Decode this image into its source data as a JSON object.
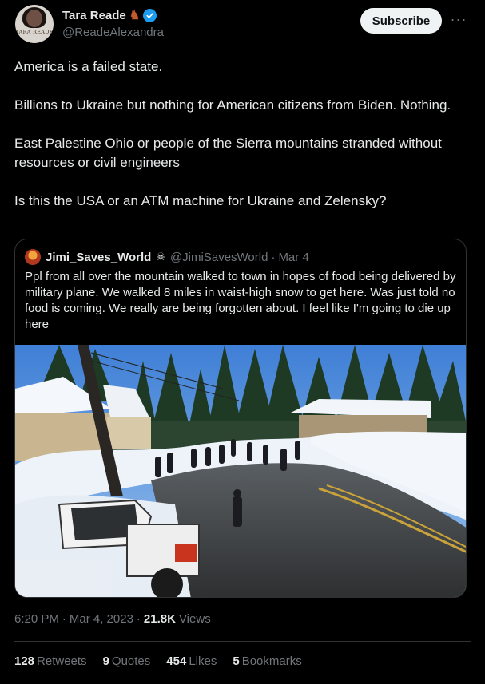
{
  "author": {
    "display_name": "Tara Reade",
    "handle": "@ReadeAlexandra",
    "avatar_text": "TARA READE",
    "name_emoji_icon": "horse-icon",
    "verified_color": "#1d9bf0"
  },
  "actions": {
    "subscribe_label": "Subscribe",
    "more_label": "···"
  },
  "tweet": {
    "paragraphs": [
      "America is a failed state.",
      "Billions to Ukraine but nothing for American citizens from Biden. Nothing.",
      "East Palestine Ohio or people of the Sierra mountains stranded without resources or civil engineers",
      "Is this the USA or an ATM machine for Ukraine and Zelensky?"
    ]
  },
  "quote": {
    "display_name": "Jimi_Saves_World",
    "name_icon": "pirate-flag-icon",
    "handle": "@JimiSavesWorld",
    "dot": "·",
    "date": "Mar 4",
    "text": "Ppl from all over the mountain walked to town in hopes of food being delivered by military plane. We walked 8 miles in waist-high snow to get here. Was just told no food is coming. We really are being forgotten about. I feel like I'm going to die up here",
    "image_icon": "snowy-street-photo"
  },
  "meta": {
    "time": "6:20 PM",
    "dot1": "·",
    "date": "Mar 4, 2023",
    "dot2": "·",
    "views_count": "21.8K",
    "views_label": "Views"
  },
  "stats": {
    "retweets_count": "128",
    "retweets_label": "Retweets",
    "quotes_count": "9",
    "quotes_label": "Quotes",
    "likes_count": "454",
    "likes_label": "Likes",
    "bookmarks_count": "5",
    "bookmarks_label": "Bookmarks"
  },
  "colors": {
    "background": "#000000",
    "text": "#e7e9ea",
    "muted": "#71767b",
    "border": "#2f3336",
    "accent": "#1d9bf0"
  }
}
